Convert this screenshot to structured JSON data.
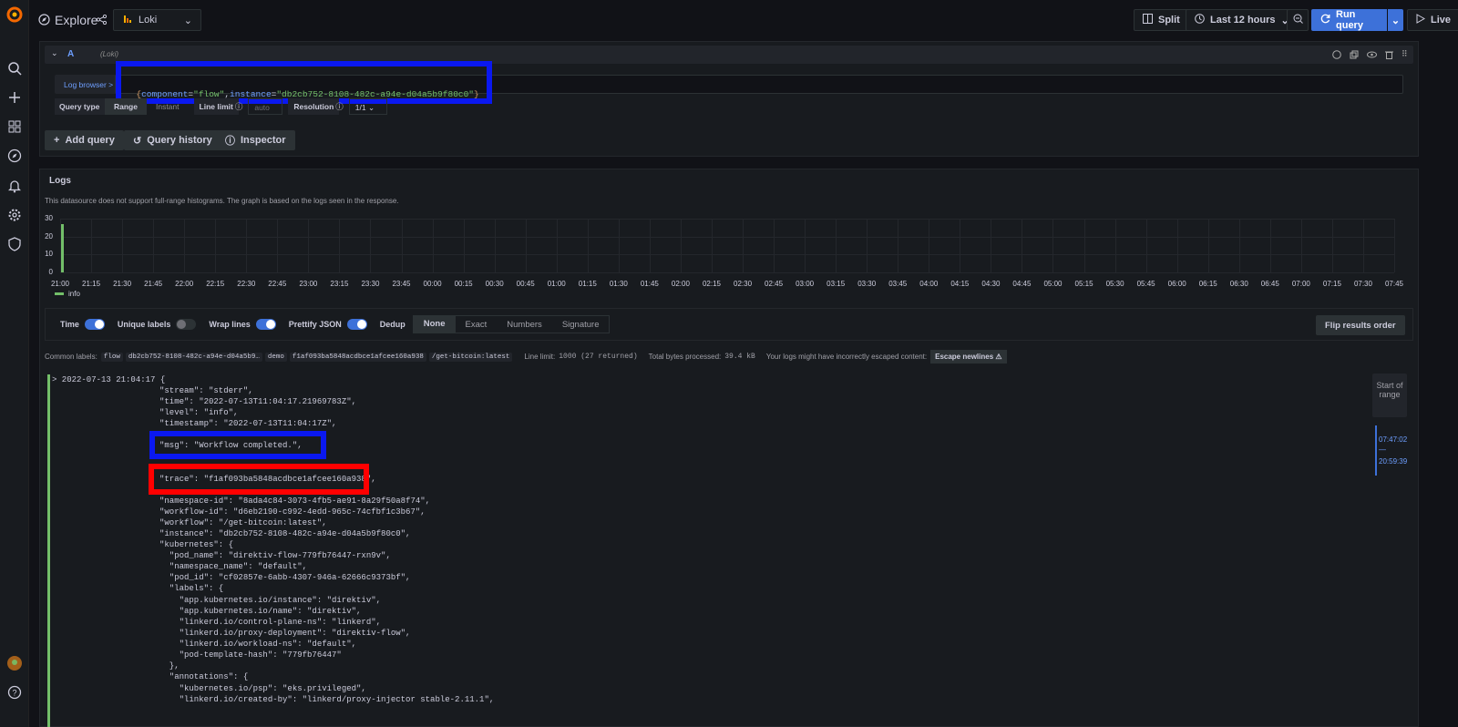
{
  "topbar": {
    "title": "Explore",
    "datasource": "Loki",
    "split_label": "Split",
    "time_range": "Last 12 hours",
    "run_label": "Run query",
    "live_label": "Live"
  },
  "query": {
    "ref_id": "A",
    "ds_hint": "(Loki)",
    "log_browser": "Log browser >",
    "expr_open": "{",
    "expr_key1": "component",
    "expr_eq1": "=",
    "expr_val1": "\"flow\"",
    "expr_comma": ",",
    "expr_key2": "instance",
    "expr_eq2": "=",
    "expr_val2": "\"db2cb752-8108-482c-a94e-d04a5b9f80c0\"",
    "expr_close": "}",
    "query_type_label": "Query type",
    "type_range": "Range",
    "type_instant": "Instant",
    "line_limit_label": "Line limit",
    "line_limit_placeholder": "auto",
    "resolution_label": "Resolution",
    "resolution_value": "1/1"
  },
  "actions": {
    "add_query": "Add query",
    "query_history": "Query history",
    "inspector": "Inspector"
  },
  "logs": {
    "title": "Logs",
    "notice": "This datasource does not support full-range histograms. The graph is based on the logs seen in the response.",
    "legend": "info"
  },
  "chart_data": {
    "type": "bar",
    "title": "",
    "x_ticks": [
      "21:00",
      "21:15",
      "21:30",
      "21:45",
      "22:00",
      "22:15",
      "22:30",
      "22:45",
      "23:00",
      "23:15",
      "23:30",
      "23:45",
      "00:00",
      "00:15",
      "00:30",
      "00:45",
      "01:00",
      "01:15",
      "01:30",
      "01:45",
      "02:00",
      "02:15",
      "02:30",
      "02:45",
      "03:00",
      "03:15",
      "03:30",
      "03:45",
      "04:00",
      "04:15",
      "04:30",
      "04:45",
      "05:00",
      "05:15",
      "05:30",
      "05:45",
      "06:00",
      "06:15",
      "06:30",
      "06:45",
      "07:00",
      "07:15",
      "07:30",
      "07:45"
    ],
    "y_ticks": [
      "30",
      "20",
      "10",
      "0"
    ],
    "ylim": [
      0,
      30
    ],
    "series": [
      {
        "name": "info",
        "color": "#73bf69",
        "x": [
          "21:00"
        ],
        "values": [
          27
        ]
      }
    ],
    "legend_position": "bottom-left",
    "grid": true
  },
  "options": {
    "time": "Time",
    "unique_labels": "Unique labels",
    "wrap_lines": "Wrap lines",
    "prettify": "Prettify JSON",
    "dedup": "Dedup",
    "dedup_opts": [
      "None",
      "Exact",
      "Numbers",
      "Signature"
    ],
    "flip": "Flip results order"
  },
  "meta": {
    "common_labels": "Common labels:",
    "labels": [
      "flow",
      "db2cb752-8108-482c-a94e-d04a5b9…",
      "demo",
      "f1af093ba5848acdbce1afcee160a938",
      "/get-bitcoin:latest"
    ],
    "line_limit": "Line limit:",
    "line_limit_val": "1000 (27 returned)",
    "bytes": "Total bytes processed:",
    "bytes_val": "39.4 kB",
    "escape_warn": "Your logs might have incorrectly escaped content:",
    "escape_btn": "Escape newlines"
  },
  "log_entry": {
    "header": "> 2022-07-13 21:04:17 {",
    "lines": [
      "\"stream\": \"stderr\",",
      "\"time\": \"2022-07-13T11:04:17.21969783Z\",",
      "\"level\": \"info\",",
      "\"timestamp\": \"2022-07-13T11:04:17Z\",",
      "\"msg\": \"Workflow completed.\",",
      "\"trace\": \"f1af093ba5848acdbce1afcee160a938\",",
      "\"namespace-id\": \"8ada4c84-3073-4fb5-ae91-8a29f50a8f74\",",
      "\"workflow-id\": \"d6eb2190-c992-4edd-965c-74cfbf1c3b67\",",
      "\"workflow\": \"/get-bitcoin:latest\",",
      "\"instance\": \"db2cb752-8108-482c-a94e-d04a5b9f80c0\",",
      "\"kubernetes\": {",
      "  \"pod_name\": \"direktiv-flow-779fb76447-rxn9v\",",
      "  \"namespace_name\": \"default\",",
      "  \"pod_id\": \"cf02857e-6abb-4307-946a-62666c9373bf\",",
      "  \"labels\": {",
      "    \"app.kubernetes.io/instance\": \"direktiv\",",
      "    \"app.kubernetes.io/name\": \"direktiv\",",
      "    \"linkerd.io/control-plane-ns\": \"linkerd\",",
      "    \"linkerd.io/proxy-deployment\": \"direktiv-flow\",",
      "    \"linkerd.io/workload-ns\": \"default\",",
      "    \"pod-template-hash\": \"779fb76447\"",
      "  },",
      "  \"annotations\": {",
      "    \"kubernetes.io/psp\": \"eks.privileged\",",
      "    \"linkerd.io/created-by\": \"linkerd/proxy-injector stable-2.11.1\","
    ]
  },
  "range_nav": {
    "start": "Start of range",
    "from": "07:47:02",
    "dash": "—",
    "to": "20:59:39"
  }
}
